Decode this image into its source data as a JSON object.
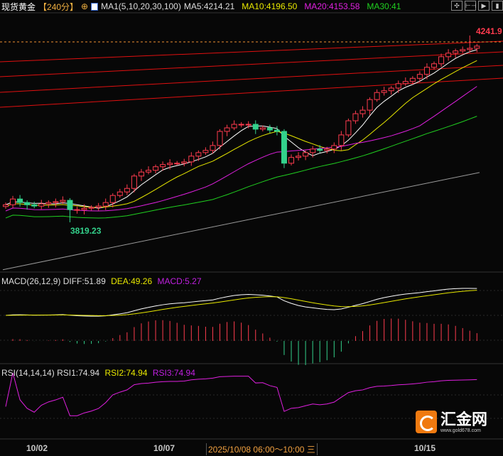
{
  "header": {
    "instrument": "现货黄金",
    "period": "【240分】",
    "indicator": "MA1(5,10,20,30,100)",
    "ma5": "MA5:4214.21",
    "ma10": "MA10:4196.50",
    "ma20": "MA20:4153.58",
    "ma30": "MA30:41"
  },
  "toolbar": [
    "crosshair-icon",
    "zoom-range-icon",
    "play-icon",
    "expand-icon"
  ],
  "colors": {
    "up": "#ff3b4e",
    "down": "#33d18b",
    "ma5": "#ffffff",
    "ma10": "#e8e800",
    "ma20": "#e020e0",
    "ma30": "#20d020",
    "ma100": "#9a9a9a"
  },
  "annotations": {
    "high": "4241.9",
    "low": "3819.23"
  },
  "macd": {
    "title": "MACD(26,12,9)",
    "diff": "DIFF:51.89",
    "dea": "DEA:49.26",
    "macd": "MACD:5.27"
  },
  "rsi": {
    "title": "RSI(14,14,14)",
    "rsi1": "RSI1:74.94",
    "rsi2": "RSI2:74.94",
    "rsi3": "RSI3:74.94"
  },
  "xaxis": {
    "d1": "10/02",
    "d2": "10/07",
    "cursor": "2025/10/08 06:00～10:00 三",
    "d3": "10/15"
  },
  "logo": {
    "name": "汇金网",
    "url": "www.gold678.com"
  },
  "chart_data": {
    "type": "candlestick",
    "closes": [
      3859,
      3872,
      3864,
      3859,
      3856,
      3861,
      3864,
      3866,
      3869,
      3848,
      3848,
      3851,
      3853,
      3856,
      3864,
      3880,
      3888,
      3896,
      3924,
      3933,
      3937,
      3945,
      3950,
      3953,
      3953,
      3956,
      3969,
      3977,
      3982,
      3993,
      4025,
      4033,
      4041,
      4041,
      4041,
      4030,
      4033,
      4028,
      4025,
      3953,
      3966,
      3969,
      3977,
      3985,
      3982,
      3985,
      3993,
      4017,
      4049,
      4065,
      4073,
      4097,
      4113,
      4117,
      4123,
      4133,
      4138,
      4145,
      4154,
      4170,
      4178,
      4194,
      4202,
      4207,
      4210,
      4213,
      4218
    ],
    "low_point": {
      "index": 9,
      "value": 3819.23
    },
    "high_point": {
      "index": 65,
      "value": 4241.9
    },
    "ma100": [
      3712,
      3932
    ],
    "price_range": [
      3660,
      4260
    ]
  }
}
